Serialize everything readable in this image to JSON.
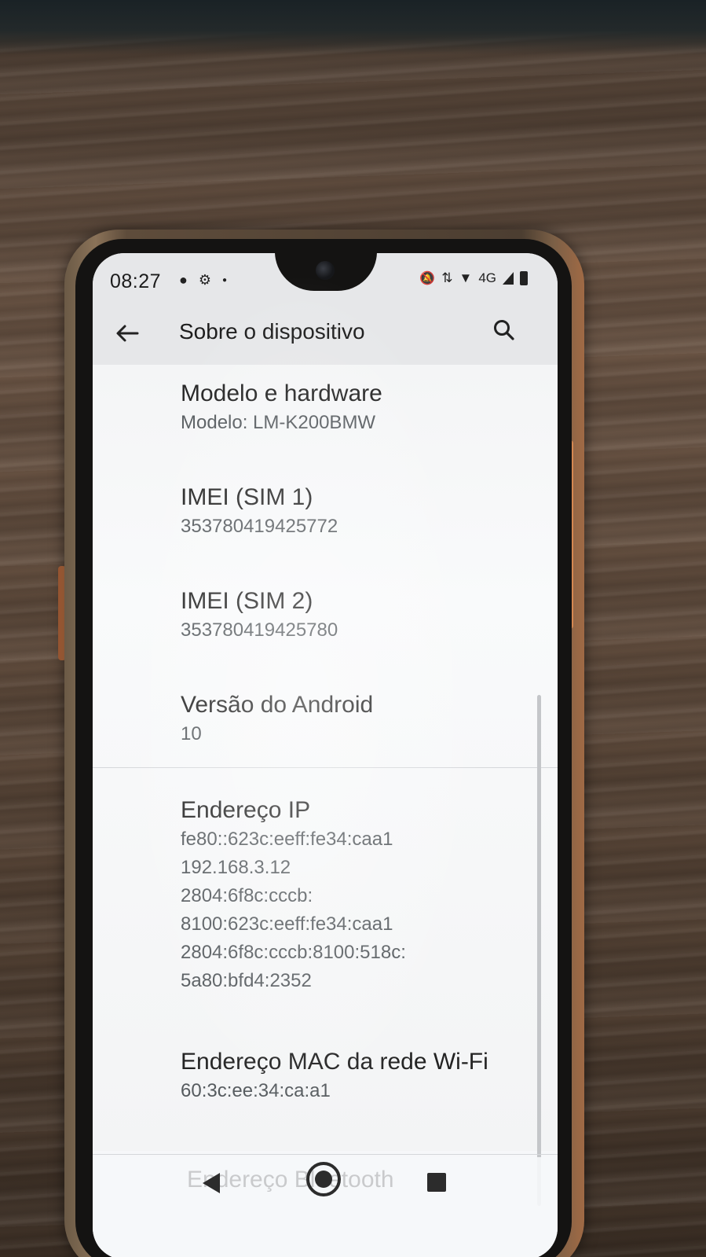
{
  "status_bar": {
    "time": "08:27",
    "network": "4G"
  },
  "app_bar": {
    "title": "Sobre o dispositivo"
  },
  "items": [
    {
      "title": "Modelo e hardware",
      "value": "Modelo: LM-K200BMW"
    },
    {
      "title": "IMEI (SIM 1)",
      "value": "353780419425772"
    },
    {
      "title": "IMEI (SIM 2)",
      "value": "353780419425780"
    },
    {
      "title": "Versão do Android",
      "value": "10"
    },
    {
      "title": "Endereço IP",
      "value": "fe80::623c:eeff:fe34:caa1\n192.168.3.12\n2804:6f8c:cccb:\n8100:623c:eeff:fe34:caa1\n2804:6f8c:cccb:8100:518c:\n5a80:bfd4:2352"
    },
    {
      "title": "Endereço MAC da rede Wi-Fi",
      "value": "60:3c:ee:34:ca:a1"
    }
  ],
  "partial_item": "Endereço Bluetooth",
  "icons": {
    "back": "arrow-left-icon",
    "search": "search-icon",
    "nav_back": "triangle-back-icon",
    "nav_home": "home-circle-icon",
    "nav_recent": "square-recent-icon"
  }
}
